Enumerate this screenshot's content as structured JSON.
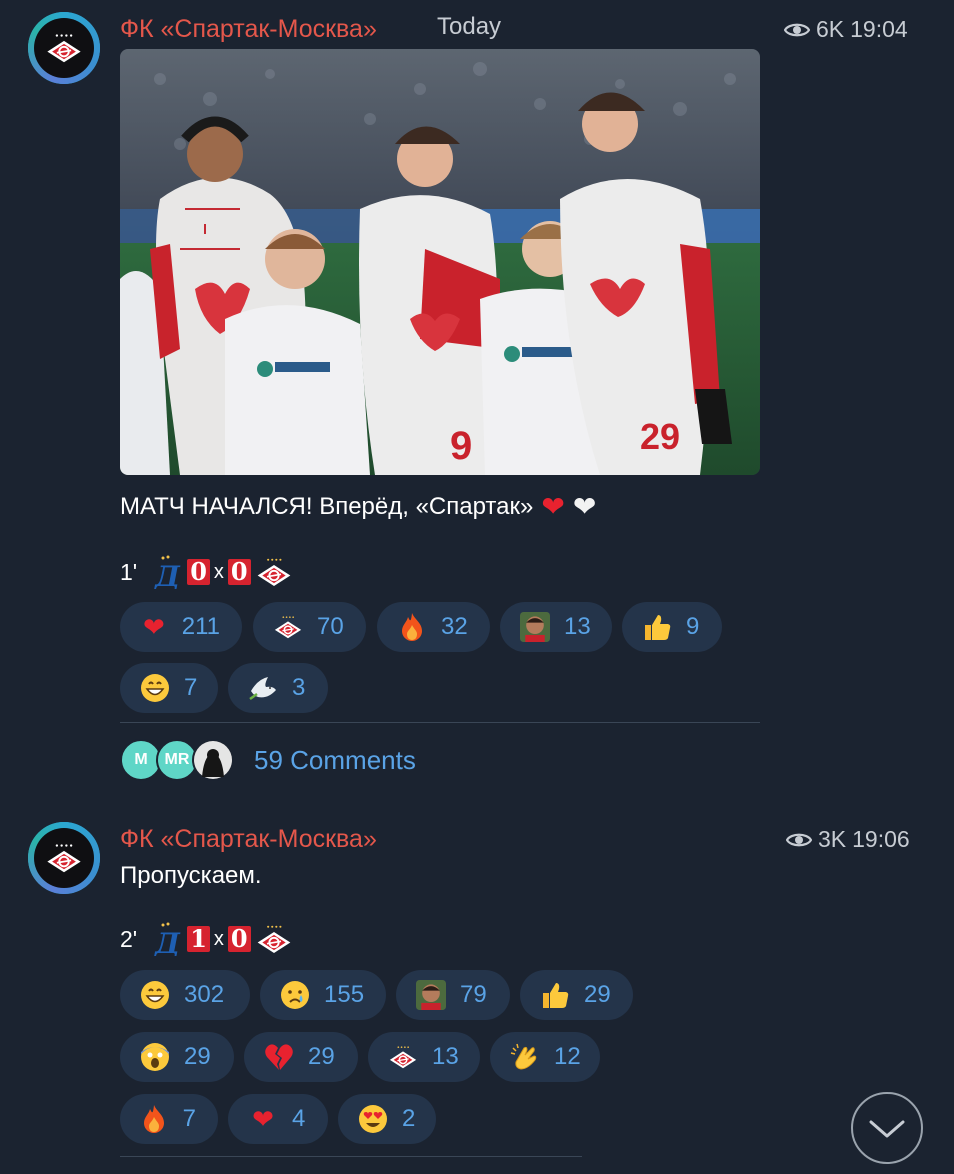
{
  "post1": {
    "channel": "ФК «Спартак-Москва»",
    "date": "Today",
    "views": "6K",
    "time": "19:04",
    "text": "МАТЧ НАЧАЛСЯ! Вперёд, «Спартак»",
    "text_emoji": [
      "red-heart",
      "white-heart"
    ],
    "score": {
      "minute": "1'",
      "home": "0",
      "sep": "x",
      "away": "0"
    },
    "reactions": [
      {
        "icon": "red-heart-icon",
        "count": "211"
      },
      {
        "icon": "spartak-logo-icon",
        "count": "70"
      },
      {
        "icon": "fire-icon",
        "count": "32"
      },
      {
        "icon": "player-face-icon",
        "count": "13"
      },
      {
        "icon": "thumbs-up-icon",
        "count": "9"
      },
      {
        "icon": "grinning-face-icon",
        "count": "7"
      },
      {
        "icon": "dove-icon",
        "count": "3"
      }
    ],
    "comments": {
      "label": "59 Comments",
      "avatars": [
        "M",
        "MR",
        ""
      ]
    }
  },
  "post2": {
    "channel": "ФК «Спартак-Москва»",
    "views": "3K",
    "time": "19:06",
    "text": "Пропускаем.",
    "score": {
      "minute": "2'",
      "home": "1",
      "sep": "x",
      "away": "0"
    },
    "reactions": [
      {
        "icon": "grinning-face-icon",
        "count": "302"
      },
      {
        "icon": "crying-face-icon",
        "count": "155"
      },
      {
        "icon": "player-face-icon",
        "count": "79"
      },
      {
        "icon": "thumbs-up-icon",
        "count": "29"
      },
      {
        "icon": "screaming-face-icon",
        "count": "29"
      },
      {
        "icon": "broken-heart-icon",
        "count": "29"
      },
      {
        "icon": "spartak-logo-icon",
        "count": "13"
      },
      {
        "icon": "clapping-hands-icon",
        "count": "12"
      },
      {
        "icon": "fire-icon",
        "count": "7"
      },
      {
        "icon": "red-heart-icon",
        "count": "4"
      },
      {
        "icon": "heart-eyes-icon",
        "count": "2"
      }
    ]
  },
  "colors": {
    "background": "#1b2330",
    "channel_name": "#e4574b",
    "accent_blue": "#5aa3e6",
    "reaction_bg": "#24344a",
    "score_digit_bg": "#d6232f"
  }
}
